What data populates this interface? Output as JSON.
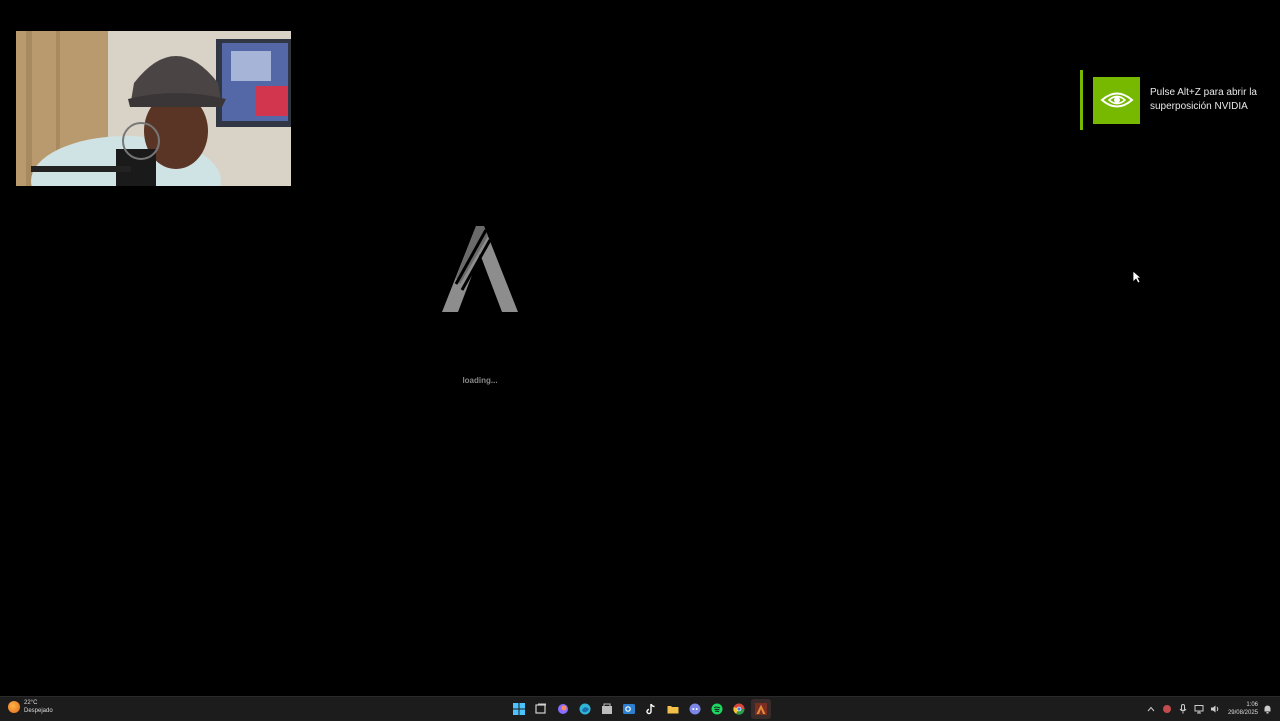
{
  "webcam": {
    "label": "streamer webcam"
  },
  "overlay": {
    "message": "Pulse Alt+Z para abrir la\nsuperposición NVIDIA",
    "accent": "#76b900"
  },
  "game": {
    "loading_label": "loading..."
  },
  "taskbar": {
    "weather_temp": "22°C",
    "weather_desc": "Despejado",
    "apps": [
      {
        "name": "start-icon",
        "color": "#4cc2ff"
      },
      {
        "name": "task-view-icon",
        "color": "#cfcfcf"
      },
      {
        "name": "copilot-icon",
        "color": "#8a6cff"
      },
      {
        "name": "edge-icon",
        "color": "#2fb5d6"
      },
      {
        "name": "store-icon",
        "color": "#bdbdbd"
      },
      {
        "name": "outlook-icon",
        "color": "#2d7fd0"
      },
      {
        "name": "tiktok-icon",
        "color": "#ffffff"
      },
      {
        "name": "file-explorer-icon",
        "color": "#f3c14a"
      },
      {
        "name": "discord-icon",
        "color": "#7b86e8"
      },
      {
        "name": "spotify-icon",
        "color": "#1ed760"
      },
      {
        "name": "chrome-icon",
        "color": "#d9473c"
      },
      {
        "name": "fivem-icon",
        "color": "#e08a3c"
      }
    ],
    "time": "1:06",
    "date": "29/08/2025"
  }
}
